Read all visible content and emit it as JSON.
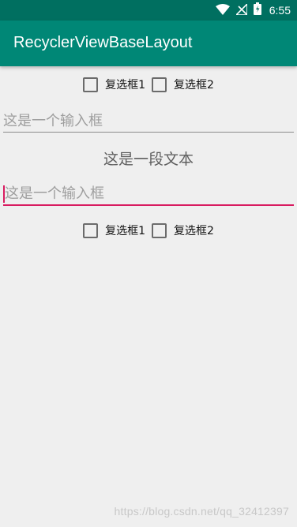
{
  "status_bar": {
    "time": "6:55",
    "icons": [
      "wifi-icon",
      "signal-icon",
      "battery-icon"
    ]
  },
  "app_bar": {
    "title": "RecyclerViewBaseLayout"
  },
  "checkbox_row_1": {
    "items": [
      {
        "label": "复选框1",
        "checked": false
      },
      {
        "label": "复选框2",
        "checked": false
      }
    ]
  },
  "input_1": {
    "placeholder": "这是一个输入框",
    "value": ""
  },
  "text_view": {
    "text": "这是一段文本"
  },
  "input_2": {
    "placeholder": "这是一个输入框",
    "value": "",
    "focused": true
  },
  "checkbox_row_2": {
    "items": [
      {
        "label": "复选框1",
        "checked": false
      },
      {
        "label": "复选框2",
        "checked": false
      }
    ]
  },
  "watermark": {
    "text": "https://blog.csdn.net/qq_32412397"
  },
  "colors": {
    "status_bar": "#006f60",
    "app_bar": "#008776",
    "accent": "#d81b60",
    "background": "#efefef"
  }
}
